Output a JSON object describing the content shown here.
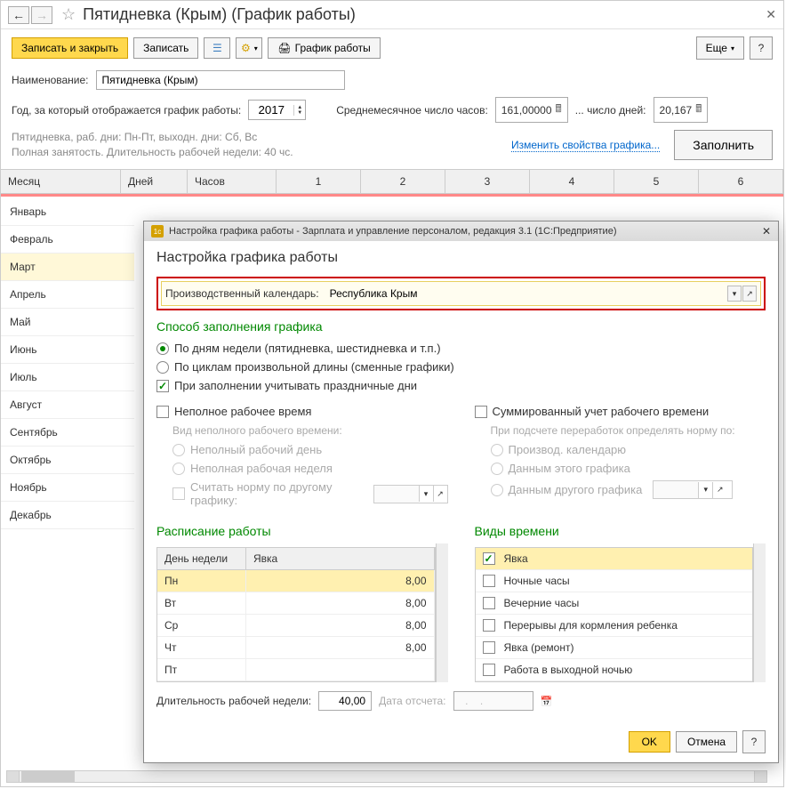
{
  "header": {
    "title": "Пятидневка (Крым) (График работы)"
  },
  "toolbar": {
    "save_close": "Записать и закрыть",
    "save": "Записать",
    "schedule": "График работы",
    "more": "Еще"
  },
  "form": {
    "name_label": "Наименование:",
    "name_value": "Пятидневка (Крым)",
    "year_label": "Год, за который отображается график работы:",
    "year_value": "2017",
    "avg_hours_label": "Среднемесячное число часов:",
    "avg_hours_value": "161,00000",
    "avg_days_label": "... число дней:",
    "avg_days_value": "20,167",
    "desc_line1": "Пятидневка, раб. дни: Пн-Пт, выходн. дни: Сб, Вс",
    "desc_line2": "Полная занятость. Длительность рабочей недели: 40 чс.",
    "change_link": "Изменить свойства графика...",
    "fill_btn": "Заполнить"
  },
  "table_headers": {
    "month": "Месяц",
    "days": "Дней",
    "hours": "Часов",
    "c1": "1",
    "c2": "2",
    "c3": "3",
    "c4": "4",
    "c5": "5",
    "c6": "6"
  },
  "months": [
    {
      "name": "Январь",
      "hl": false
    },
    {
      "name": "Февраль",
      "hl": false
    },
    {
      "name": "Март",
      "hl": true
    },
    {
      "name": "Апрель",
      "hl": false
    },
    {
      "name": "Май",
      "hl": false
    },
    {
      "name": "Июнь",
      "hl": false
    },
    {
      "name": "Июль",
      "hl": false
    },
    {
      "name": "Август",
      "hl": false
    },
    {
      "name": "Сентябрь",
      "hl": false
    },
    {
      "name": "Октябрь",
      "hl": false
    },
    {
      "name": "Ноябрь",
      "hl": false
    },
    {
      "name": "Декабрь",
      "hl": false
    }
  ],
  "dialog": {
    "titlebar": "Настройка графика работы - Зарплата и управление персоналом, редакция 3.1  (1С:Предприятие)",
    "heading": "Настройка графика работы",
    "calendar_label": "Производственный календарь:",
    "calendar_value": "Республика Крым",
    "fill_method_heading": "Способ заполнения графика",
    "radio_weekly": "По дням недели (пятидневка, шестидневка и т.п.)",
    "radio_cycles": "По циклам произвольной длины (сменные графики)",
    "check_holidays": "При заполнении учитывать праздничные дни",
    "check_parttime": "Неполное рабочее время",
    "sub_parttime_label": "Вид неполного рабочего времени:",
    "radio_partday": "Неполный рабочий день",
    "radio_partweek": "Неполная рабочая неделя",
    "check_othernorm": "Считать норму по другому графику:",
    "check_summed": "Суммированный учет рабочего времени",
    "sub_overtime_label": "При подсчете переработок определять норму по:",
    "radio_prodcal": "Производ. календарю",
    "radio_thisgraph": "Данным этого графика",
    "radio_othergraph": "Данным другого графика",
    "schedule_heading": "Расписание работы",
    "sched_th_day": "День недели",
    "sched_th_attend": "Явка",
    "schedule_rows": [
      {
        "day": "Пн",
        "val": "8,00",
        "sel": true
      },
      {
        "day": "Вт",
        "val": "8,00",
        "sel": false
      },
      {
        "day": "Ср",
        "val": "8,00",
        "sel": false
      },
      {
        "day": "Чт",
        "val": "8,00",
        "sel": false
      },
      {
        "day": "Пт",
        "val": "",
        "sel": false
      }
    ],
    "types_heading": "Виды времени",
    "types_rows": [
      {
        "name": "Явка",
        "checked": true,
        "sel": true
      },
      {
        "name": "Ночные часы",
        "checked": false,
        "sel": false
      },
      {
        "name": "Вечерние часы",
        "checked": false,
        "sel": false
      },
      {
        "name": "Перерывы для кормления ребенка",
        "checked": false,
        "sel": false
      },
      {
        "name": "Явка (ремонт)",
        "checked": false,
        "sel": false
      },
      {
        "name": "Работа в выходной ночью",
        "checked": false,
        "sel": false
      }
    ],
    "week_duration_label": "Длительность рабочей недели:",
    "week_duration_value": "40,00",
    "start_date_label": "Дата отсчета:",
    "start_date_value": "  .    .",
    "ok": "OK",
    "cancel": "Отмена"
  }
}
